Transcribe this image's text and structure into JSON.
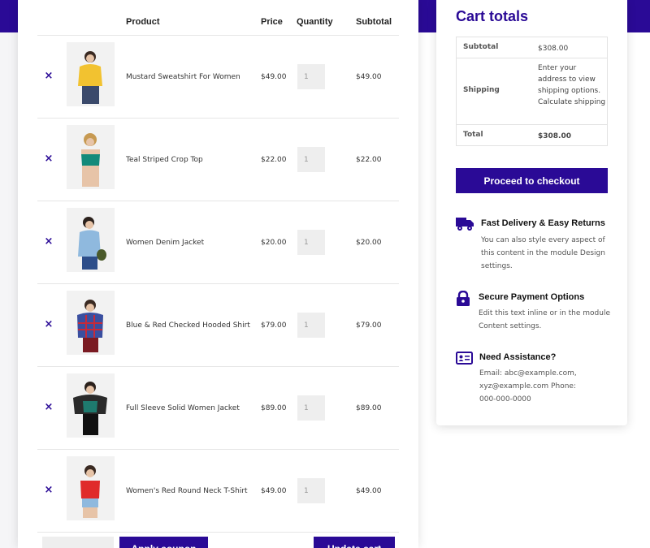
{
  "cart": {
    "headers": {
      "product": "Product",
      "price": "Price",
      "quantity": "Quantity",
      "subtotal": "Subtotal"
    },
    "remove_symbol": "×",
    "items": [
      {
        "name": "Mustard Sweatshirt For Women",
        "price": "$49.00",
        "quantity": "1",
        "subtotal": "$49.00",
        "color": "#f2c230"
      },
      {
        "name": "Teal Striped Crop Top",
        "price": "$22.00",
        "quantity": "1",
        "subtotal": "$22.00",
        "color": "#138a7a"
      },
      {
        "name": "Women Denim Jacket",
        "price": "$20.00",
        "quantity": "1",
        "subtotal": "$20.00",
        "color": "#8fb9de"
      },
      {
        "name": "Blue & Red Checked Hooded Shirt",
        "price": "$79.00",
        "quantity": "1",
        "subtotal": "$79.00",
        "color": "#3a4fa0"
      },
      {
        "name": "Full Sleeve Solid Women Jacket",
        "price": "$89.00",
        "quantity": "1",
        "subtotal": "$89.00",
        "color": "#1e7a6e"
      },
      {
        "name": "Women's Red Round Neck T-Shirt",
        "price": "$49.00",
        "quantity": "1",
        "subtotal": "$49.00",
        "color": "#e02a2a"
      }
    ],
    "apply_coupon_label": "Apply coupon",
    "update_cart_label": "Update cart"
  },
  "totals": {
    "title": "Cart totals",
    "subtotal_label": "Subtotal",
    "subtotal_value": "$308.00",
    "shipping_label": "Shipping",
    "shipping_value": "Enter your address to view shipping options. Calculate shipping",
    "total_label": "Total",
    "total_value": "$308.00",
    "checkout_label": "Proceed to checkout"
  },
  "features": [
    {
      "icon": "truck-icon",
      "title": "Fast Delivery & Easy Returns",
      "body": "You can also style every aspect of this content in the module Design settings."
    },
    {
      "icon": "lock-icon",
      "title": "Secure Payment Options",
      "body": "Edit this text inline or in the module Content settings."
    },
    {
      "icon": "contact-card-icon",
      "title": "Need Assistance?",
      "body": "Email: abc@example.com, xyz@example.com Phone: 000-000-0000"
    }
  ],
  "theme": {
    "accent": "#2a0a96"
  }
}
